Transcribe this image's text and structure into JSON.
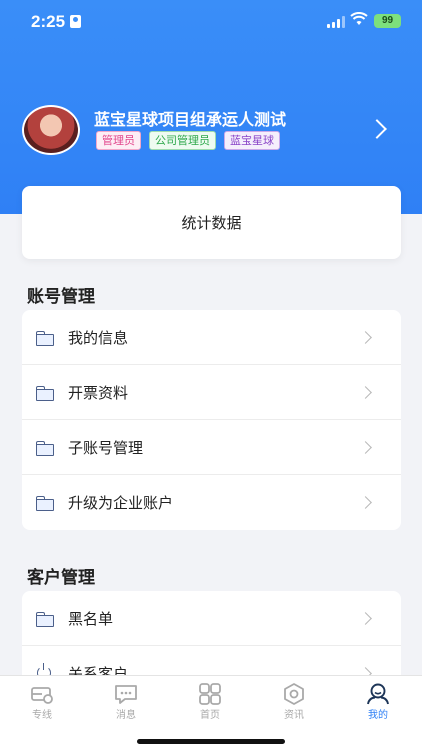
{
  "status_bar": {
    "time": "2:25",
    "battery": "99"
  },
  "profile": {
    "name": "蓝宝星球项目组承运人测试",
    "tags": [
      "管理员",
      "公司管理员",
      "蓝宝星球"
    ]
  },
  "stats": {
    "label": "统计数据"
  },
  "account_section": {
    "title": "账号管理",
    "items": [
      {
        "label": "我的信息",
        "icon": "folder-icon"
      },
      {
        "label": "开票资料",
        "icon": "folder-icon"
      },
      {
        "label": "子账号管理",
        "icon": "folder-icon"
      },
      {
        "label": "升级为企业账户",
        "icon": "folder-icon"
      }
    ]
  },
  "customer_section": {
    "title": "客户管理",
    "items": [
      {
        "label": "黑名单",
        "icon": "folder-icon"
      },
      {
        "label": "关系客户",
        "icon": "power-icon"
      }
    ]
  },
  "tab_bar": {
    "active": "我的",
    "active_color": "#2f80f5",
    "tabs": [
      {
        "label": "专线",
        "icon": "route-icon"
      },
      {
        "label": "消息",
        "icon": "message-icon"
      },
      {
        "label": "首页",
        "icon": "grid-icon"
      },
      {
        "label": "资讯",
        "icon": "hexagon-icon"
      },
      {
        "label": "我的",
        "icon": "user-icon"
      }
    ]
  },
  "colors": {
    "header_blue": "#2f80f5",
    "background": "#f2f3f7"
  }
}
